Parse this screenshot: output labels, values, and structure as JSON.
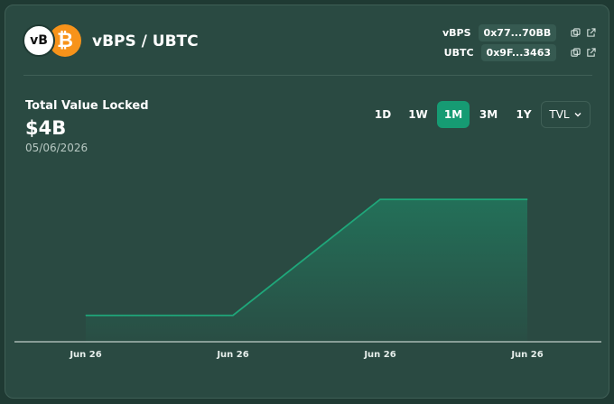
{
  "pair": {
    "title": "vBPS / UBTC",
    "logo_left_text": "vB",
    "logo_right_icon": "bitcoin-icon"
  },
  "tokens": [
    {
      "symbol": "vBPS",
      "address": "0x77...70BB"
    },
    {
      "symbol": "UBTC",
      "address": "0x9F...3463"
    }
  ],
  "metric": {
    "label": "Total Value Locked",
    "value": "$4B",
    "date": "05/06/2026"
  },
  "ranges": {
    "items": [
      "1D",
      "1W",
      "1M",
      "3M",
      "1Y"
    ],
    "active": "1M"
  },
  "metric_select": {
    "value": "TVL"
  },
  "colors": {
    "accent": "#169b73",
    "line": "#1fa77a",
    "background": "#2a4a42"
  },
  "chart_data": {
    "type": "area",
    "x": [
      "Jun 26",
      "Jun 26",
      "Jun 26",
      "Jun 26"
    ],
    "values": [
      1.8,
      1.8,
      4.0,
      4.0
    ],
    "ylim": [
      1.3,
      4.6
    ],
    "grid": false,
    "legend": "none"
  }
}
